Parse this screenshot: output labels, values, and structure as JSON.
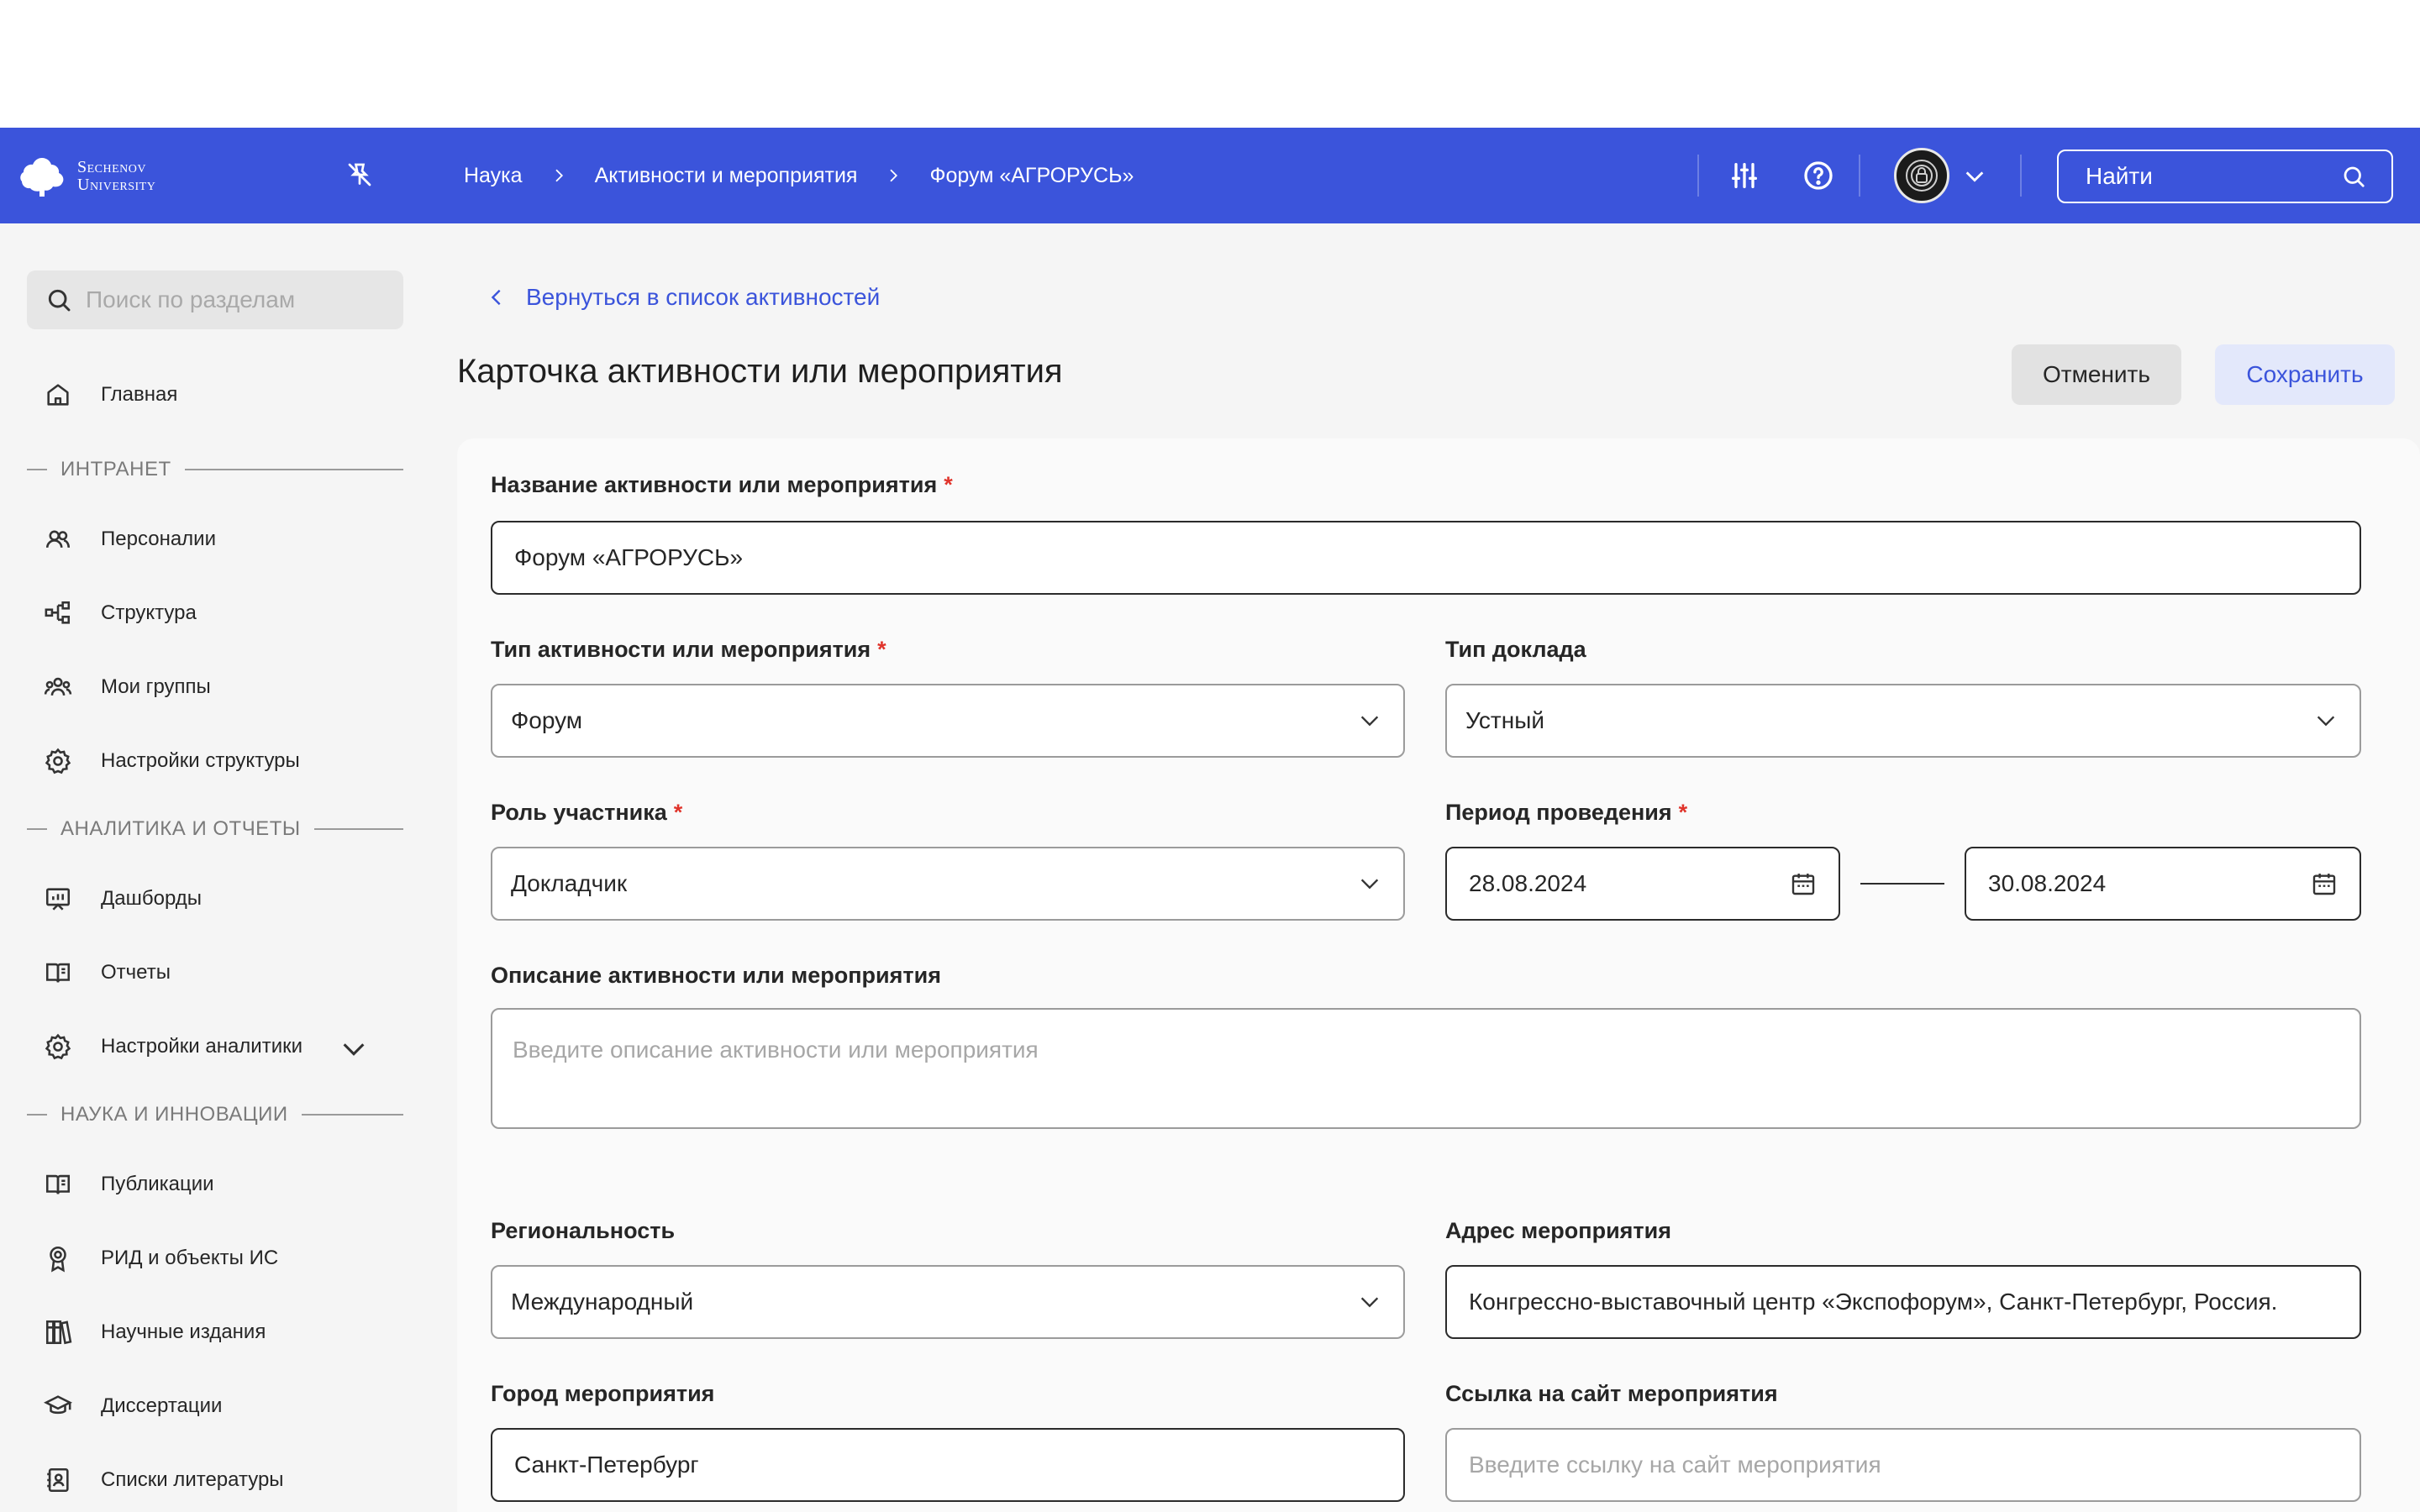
{
  "app": {
    "logo_line1": "Sechenov",
    "logo_line2": "University"
  },
  "breadcrumbs": [
    "Наука",
    "Активности и мероприятия",
    "Форум «АГРОРУСЬ»"
  ],
  "top_search": {
    "label": "Найти"
  },
  "sidebar": {
    "search_placeholder": "Поиск по разделам",
    "home": "Главная",
    "sections": [
      {
        "title": "ИНТРАНЕТ",
        "items": [
          "Персоналии",
          "Структура",
          "Мои группы",
          "Настройки структуры"
        ]
      },
      {
        "title": "АНАЛИТИКА И ОТЧЕТЫ",
        "items": [
          "Дашборды",
          "Отчеты",
          "Настройки аналитики"
        ]
      },
      {
        "title": "НАУКА И ИННОВАЦИИ",
        "items": [
          "Публикации",
          "РИД и объекты ИС",
          "Научные издания",
          "Диссертации",
          "Списки литературы"
        ]
      }
    ]
  },
  "main": {
    "back_link": "Вернуться в список активностей",
    "title": "Карточка активности или мероприятия",
    "cancel": "Отменить",
    "save": "Сохранить"
  },
  "form": {
    "name_label": "Название активности или мероприятия",
    "name_value": "Форум «АГРОРУСЬ»",
    "type_label": "Тип активности или мероприятия",
    "type_value": "Форум",
    "report_label": "Тип доклада",
    "report_value": "Устный",
    "role_label": "Роль участника",
    "role_value": "Докладчик",
    "period_label": "Период проведения",
    "date_from": "28.08.2024",
    "date_to": "30.08.2024",
    "desc_label": "Описание активности или мероприятия",
    "desc_placeholder": "Введите описание активности или мероприятия",
    "region_label": "Региональность",
    "region_value": "Международный",
    "address_label": "Адрес мероприятия",
    "address_value": "Конгрессно-выставочный центр «Экспофорум», Санкт-Петербург, Россия.",
    "city_label": "Город мероприятия",
    "city_value": "Санкт-Петербург",
    "site_label": "Ссылка на сайт мероприятия",
    "site_placeholder": "Введите ссылку на сайт мероприятия",
    "required_mark": "*"
  },
  "colors": {
    "accent": "#3b54db",
    "required": "#e0342b"
  }
}
